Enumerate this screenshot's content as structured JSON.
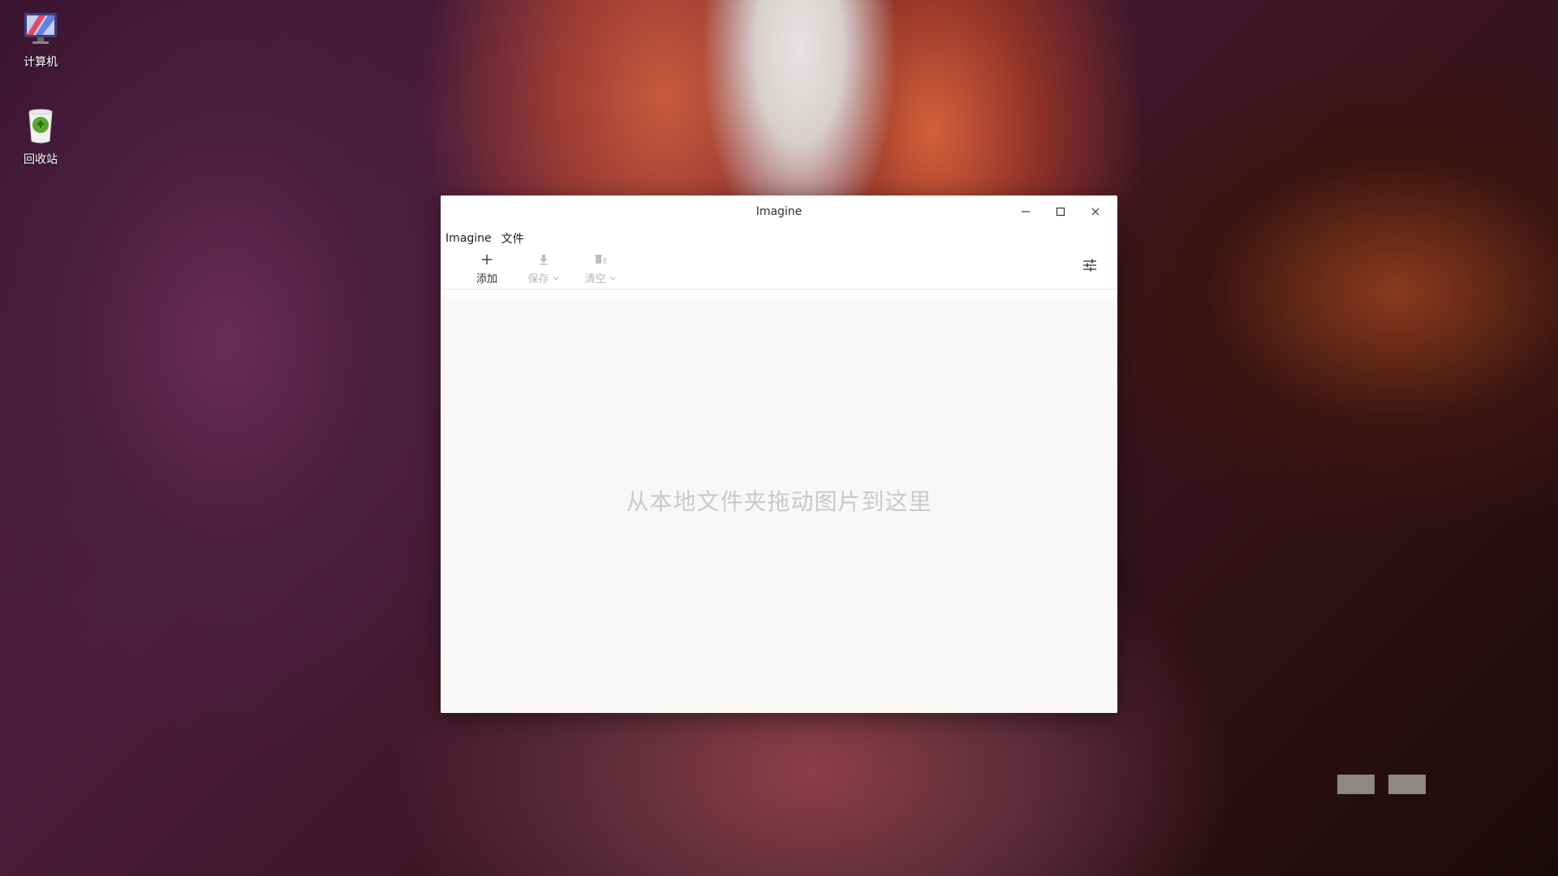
{
  "desktop": {
    "icons": [
      {
        "label": "计算机",
        "icon": "computer-icon"
      },
      {
        "label": "回收站",
        "icon": "trash-icon"
      }
    ]
  },
  "window": {
    "title": "Imagine",
    "menu": [
      "Imagine",
      "文件"
    ],
    "toolbar": {
      "add_label": "添加",
      "save_label": "保存",
      "clear_label": "清空",
      "settings_icon": "sliders-icon"
    },
    "drop_hint": "从本地文件夹拖动图片到这里"
  },
  "colors": {
    "window_bg": "#ffffff",
    "content_bg": "#f9f8f7",
    "hint_text": "#c9c9c9",
    "disabled_text": "#b5b5b5"
  }
}
